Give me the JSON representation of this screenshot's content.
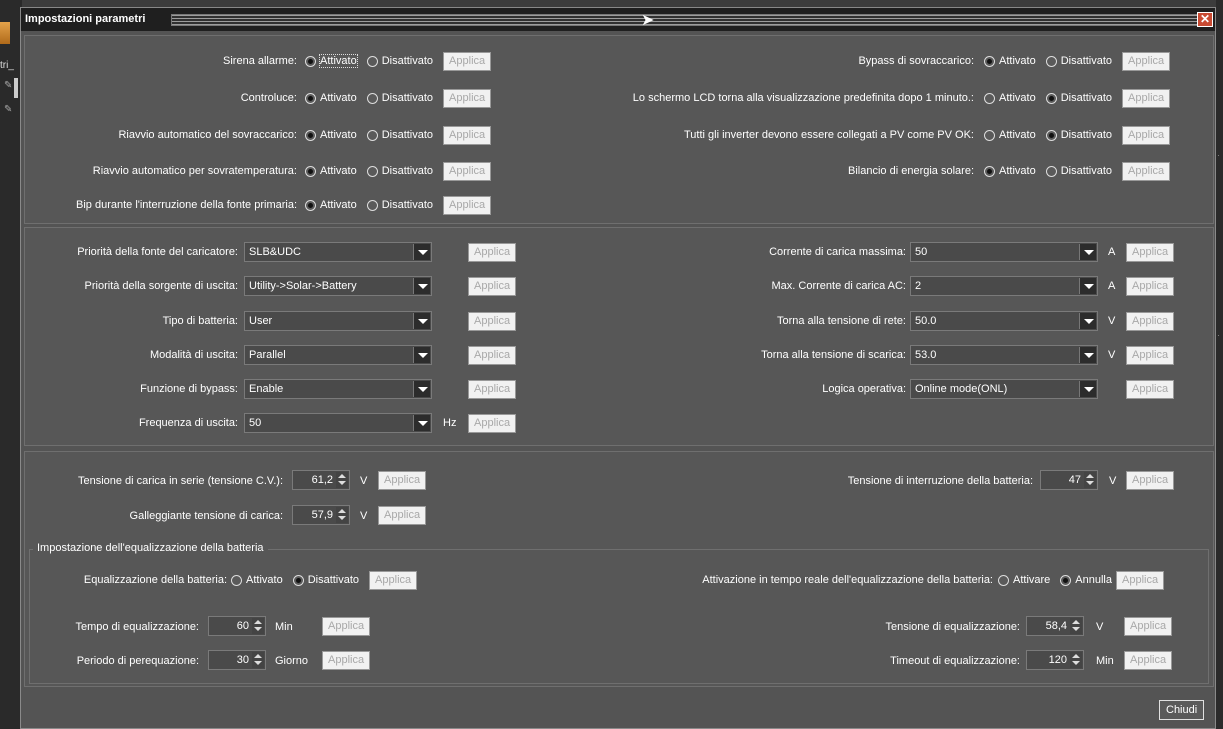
{
  "window": {
    "title": "Impostazioni parametri",
    "close_glyph": "✕"
  },
  "left_strip": {
    "text": "tri_"
  },
  "buttons": {
    "apply": "Applica",
    "close": "Chiudi"
  },
  "radio": {
    "on": "Attivato",
    "off": "Disattivato",
    "activate": "Attivare",
    "cancel": "Annulla"
  },
  "toggles_left": [
    {
      "label": "Sirena allarme:",
      "state": "on"
    },
    {
      "label": "Controluce:",
      "state": "on"
    },
    {
      "label": "Riavvio automatico del sovraccarico:",
      "state": "on"
    },
    {
      "label": "Riavvio automatico per sovratemperatura:",
      "state": "on"
    },
    {
      "label": "Bip durante l'interruzione della fonte primaria:",
      "state": "on"
    }
  ],
  "toggles_right": [
    {
      "label": "Bypass di sovraccarico:",
      "state": "on"
    },
    {
      "label": "Lo schermo LCD torna alla visualizzazione predefinita dopo 1 minuto.:",
      "state": "off"
    },
    {
      "label": "Tutti gli inverter devono essere collegati a PV come PV OK:",
      "state": "off"
    },
    {
      "label": "Bilancio di energia solare:",
      "state": "on"
    }
  ],
  "combos_left": [
    {
      "label": "Priorità della fonte del caricatore:",
      "value": "SLB&UDC",
      "unit": ""
    },
    {
      "label": "Priorità della sorgente di uscita:",
      "value": "Utility->Solar->Battery",
      "unit": ""
    },
    {
      "label": "Tipo di batteria:",
      "value": "User",
      "unit": ""
    },
    {
      "label": "Modalità di uscita:",
      "value": "Parallel",
      "unit": ""
    },
    {
      "label": "Funzione di bypass:",
      "value": "Enable",
      "unit": ""
    },
    {
      "label": "Frequenza di uscita:",
      "value": "50",
      "unit": "Hz"
    }
  ],
  "combos_right": [
    {
      "label": "Corrente di carica massima:",
      "value": "50",
      "unit": "A"
    },
    {
      "label": "Max. Corrente di carica AC:",
      "value": "2",
      "unit": "A"
    },
    {
      "label": "Torna alla tensione di rete:",
      "value": "50.0",
      "unit": "V"
    },
    {
      "label": "Torna alla tensione di scarica:",
      "value": "53.0",
      "unit": "V"
    },
    {
      "label": "Logica operativa:",
      "value": "Online mode(ONL)",
      "unit": ""
    }
  ],
  "voltage": {
    "cv_label": "Tensione di carica in serie (tensione C.V.):",
    "cv_value": "61,2",
    "cv_unit": "V",
    "float_label": "Galleggiante tensione di carica:",
    "float_value": "57,9",
    "float_unit": "V",
    "cutoff_label": "Tensione di interruzione della batteria:",
    "cutoff_value": "47",
    "cutoff_unit": "V"
  },
  "equalization": {
    "title": "Impostazione dell'equalizzazione della batteria",
    "eq_label": "Equalizzazione della batteria:",
    "eq_state": "off",
    "rt_label": "Attivazione in tempo reale dell'equalizzazione della batteria:",
    "rt_state": "cancel",
    "time_label": "Tempo di equalizzazione:",
    "time_value": "60",
    "time_unit": "Min",
    "period_label": "Periodo di perequazione:",
    "period_value": "30",
    "period_unit": "Giorno",
    "voltage_label": "Tensione di equalizzazione:",
    "voltage_value": "58,4",
    "voltage_unit": "V",
    "timeout_label": "Timeout di equalizzazione:",
    "timeout_value": "120",
    "timeout_unit": "Min"
  }
}
